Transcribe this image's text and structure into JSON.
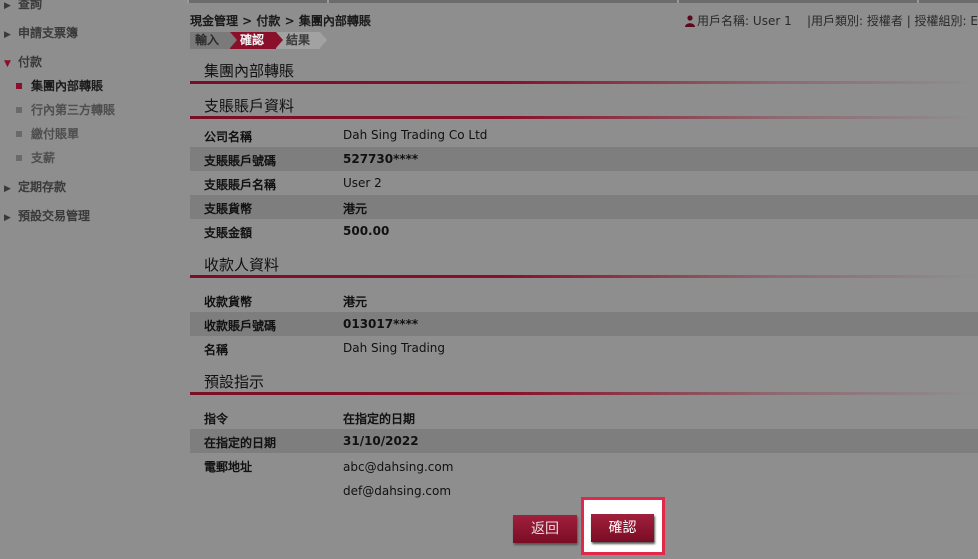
{
  "sidebar": {
    "items": [
      {
        "label": "查詢"
      },
      {
        "label": "申請支票簿"
      },
      {
        "label": "付款"
      },
      {
        "label": "定期存款"
      },
      {
        "label": "預設交易管理"
      }
    ],
    "payment_sub": [
      {
        "label": "集團內部轉賬"
      },
      {
        "label": "行內第三方轉賬"
      },
      {
        "label": "繳付賬單"
      },
      {
        "label": "支薪"
      }
    ]
  },
  "header": {
    "breadcrumb": "現金管理 > 付款 > 集團內部轉賬",
    "user_name_label": "用戶名稱:",
    "user_name": "User 1",
    "user_type": "|用戶類別: 授權者 | 授權組別: E"
  },
  "steps": [
    "輸入",
    "確認",
    "結果"
  ],
  "main": {
    "page_title": "集團內部轉賬",
    "debit": {
      "title": "支賬賬戶資料",
      "rows": [
        {
          "label": "公司名稱",
          "value": "Dah Sing Trading Co Ltd"
        },
        {
          "label": "支賬賬戶號碼",
          "value": "527730****"
        },
        {
          "label": "支賬賬戶名稱",
          "value": "User 2"
        },
        {
          "label": "支賬貨幣",
          "value": "港元"
        },
        {
          "label": "支賬金額",
          "value": "500.00"
        }
      ]
    },
    "payee": {
      "title": "收款人資料",
      "rows": [
        {
          "label": "收款貨幣",
          "value": "港元"
        },
        {
          "label": "收款賬戶號碼",
          "value": "013017****"
        },
        {
          "label": "名稱",
          "value": "Dah Sing Trading"
        }
      ]
    },
    "preset": {
      "title": "預設指示",
      "rows": [
        {
          "label": "指令",
          "value": "在指定的日期"
        },
        {
          "label": "在指定的日期",
          "value": "31/10/2022"
        },
        {
          "label": "電郵地址",
          "value": "abc@dahsing.com"
        },
        {
          "label": "",
          "value": "def@dahsing.com"
        }
      ]
    }
  },
  "buttons": {
    "back": "返回",
    "confirm": "確認"
  },
  "colors": {
    "overlay_gray": "#8e8e8e",
    "brand_maroon": "#8a0f2a",
    "highlight_red": "#e0284a"
  }
}
